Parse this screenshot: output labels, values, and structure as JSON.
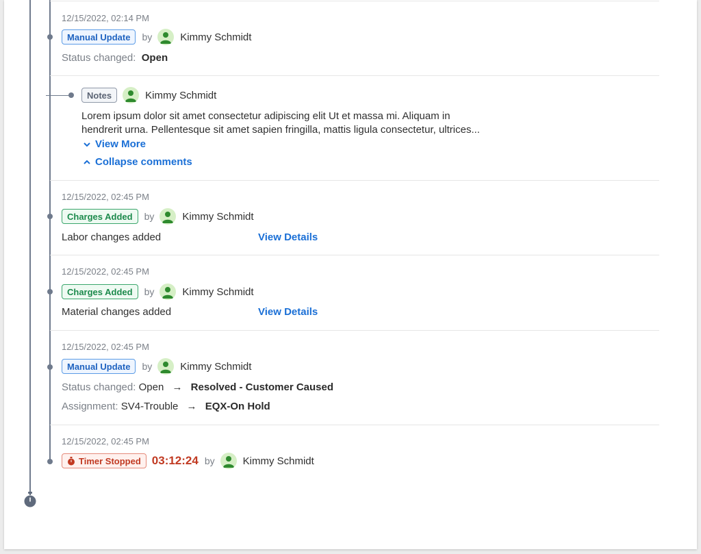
{
  "entries": [
    {
      "timestamp": "12/15/2022, 02:14 PM",
      "badge": "Manual Update",
      "by": "by",
      "user": "Kimmy Schmidt",
      "status_label": "Status changed:",
      "status_value": "Open"
    },
    {
      "badge": "Notes",
      "user": "Kimmy Schmidt",
      "body_line1": "Lorem ipsum dolor sit amet consectetur adipiscing elit Ut et massa mi. Aliquam in",
      "body_line2": "hendrerit urna. Pellentesque sit amet sapien fringilla, mattis ligula consectetur, ultrices...",
      "view_more": "View More",
      "collapse": "Collapse comments"
    },
    {
      "timestamp": "12/15/2022, 02:45 PM",
      "badge": "Charges Added",
      "by": "by",
      "user": "Kimmy Schmidt",
      "description": "Labor changes added",
      "link": "View Details"
    },
    {
      "timestamp": "12/15/2022, 02:45 PM",
      "badge": "Charges Added",
      "by": "by",
      "user": "Kimmy Schmidt",
      "description": "Material changes added",
      "link": "View Details"
    },
    {
      "timestamp": "12/15/2022, 02:45 PM",
      "badge": "Manual Update",
      "by": "by",
      "user": "Kimmy Schmidt",
      "status_label": "Status changed:",
      "status_from": "Open",
      "status_to": "Resolved - Customer Caused",
      "assign_label": "Assignment:",
      "assign_from": "SV4-Trouble",
      "assign_to": "EQX-On Hold"
    },
    {
      "timestamp": "12/15/2022, 02:45 PM",
      "badge": "Timer Stopped",
      "timer_value": "03:12:24",
      "by": "by",
      "user": "Kimmy Schmidt"
    }
  ],
  "colors": {
    "timeline": "#6f7a8c",
    "link": "#1a6fd6",
    "manual_badge": "#1f63c0",
    "charges_badge": "#1c8a4c",
    "timer_badge": "#c13a22",
    "avatar_bg": "#d6efc6",
    "avatar_fg": "#2e8a2e"
  },
  "icons": {
    "user": "user-avatar-icon",
    "arrow": "arrow-right-icon",
    "chevron_down": "chevron-down-icon",
    "chevron_up": "chevron-up-icon",
    "stopwatch": "stopwatch-icon"
  }
}
